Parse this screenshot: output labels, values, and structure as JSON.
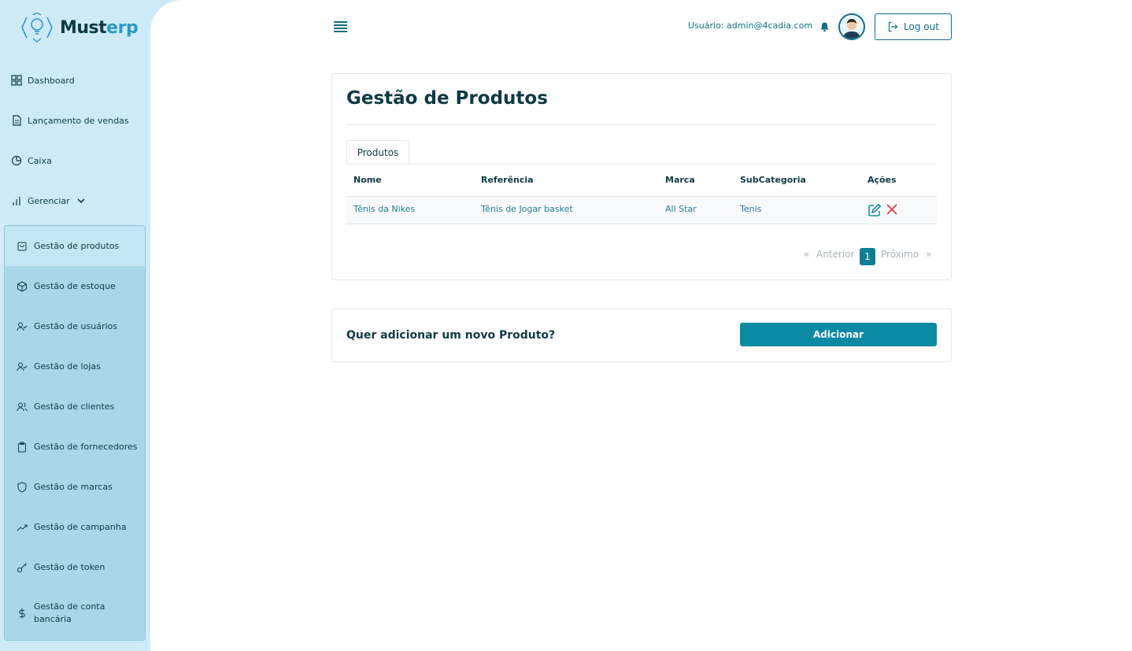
{
  "brand": {
    "name_main": "Must",
    "name_accent": "erp"
  },
  "sidebar": {
    "items": [
      {
        "label": "Dashboard",
        "icon": "grid-icon"
      },
      {
        "label": "Lançamento de vendas",
        "icon": "document-icon"
      },
      {
        "label": "Caixa",
        "icon": "pie-chart-icon"
      },
      {
        "label": "Gerenciar",
        "icon": "bar-chart-icon"
      }
    ],
    "submenu": [
      {
        "label": "Gestão de produtos",
        "icon": "shopping-bag-icon",
        "active": true
      },
      {
        "label": "Gestão de estoque",
        "icon": "box-icon"
      },
      {
        "label": "Gestão de usuários",
        "icon": "user-check-icon"
      },
      {
        "label": "Gestão de lojas",
        "icon": "user-check-icon"
      },
      {
        "label": "Gestão de clientes",
        "icon": "users-icon"
      },
      {
        "label": "Gestão de fornecedores",
        "icon": "clipboard-icon"
      },
      {
        "label": "Gestão de marcas",
        "icon": "shield-icon"
      },
      {
        "label": "Gestão de campanha",
        "icon": "trending-up-icon"
      },
      {
        "label": "Gestão de token",
        "icon": "key-icon"
      },
      {
        "label_line1": "Gestão de conta",
        "label_line2": "bancária",
        "icon": "dollar-icon"
      }
    ]
  },
  "header": {
    "user_text": "Usuário: admin@4cadia.com",
    "logout_label": "Log out"
  },
  "main": {
    "title": "Gestão de Produtos",
    "tab_label": "Produtos",
    "table": {
      "columns": [
        "Nome",
        "Referência",
        "Marca",
        "SubCategoria",
        "Ações"
      ],
      "rows": [
        {
          "nome": "Tênis da Nikes",
          "referencia": "Tênis de Jogar basket",
          "marca": "All Star",
          "subcategoria": "Tenis"
        }
      ]
    },
    "pagination": {
      "prev_symbol": "«",
      "prev": "Anterior",
      "current": "1",
      "next": "Próximo",
      "next_symbol": "»"
    }
  },
  "add_section": {
    "question": "Quer adicionar um novo Produto?",
    "button_label": "Adicionar"
  },
  "colors": {
    "accent": "#0b8aa3",
    "sidebar_bg": "#cfeaf7",
    "submenu_bg": "#a8d8e7",
    "delete": "#d9363e"
  }
}
